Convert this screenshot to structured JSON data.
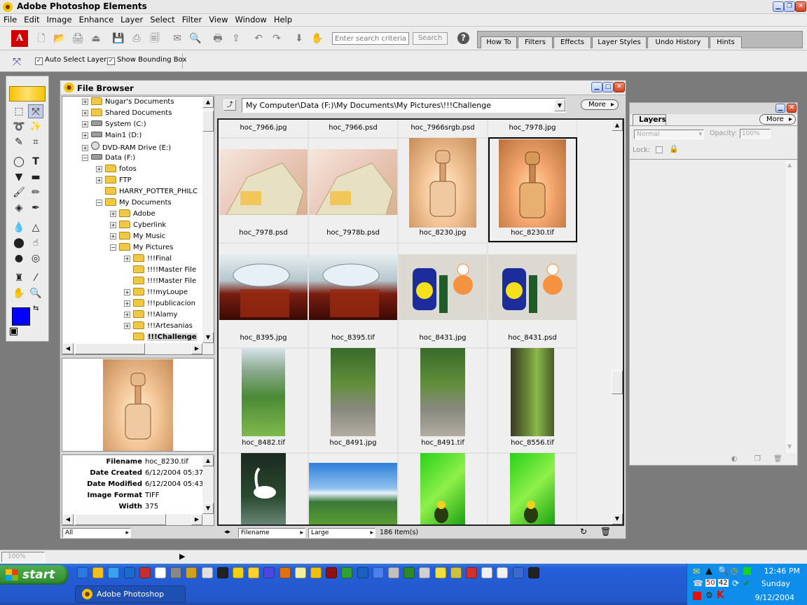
{
  "app": {
    "title": "Adobe Photoshop Elements"
  },
  "menu": [
    "File",
    "Edit",
    "Image",
    "Enhance",
    "Layer",
    "Select",
    "Filter",
    "View",
    "Window",
    "Help"
  ],
  "toolbar": {
    "search_placeholder": "Enter search criteria",
    "search_button": "Search",
    "palette_tabs": [
      "How To",
      "Filters",
      "Effects",
      "Layer Styles",
      "Undo History",
      "Hints"
    ]
  },
  "options": {
    "auto_select": "Auto Select Layer",
    "show_bbox": "Show Bounding Box"
  },
  "file_browser": {
    "title": "File Browser",
    "path": "My Computer\\Data (F:)\\My Documents\\My Pictures\\!!!Challenge",
    "more": "More",
    "tree": [
      {
        "label": "Nugar's Documents",
        "type": "folder",
        "indent": 1
      },
      {
        "label": "Shared Documents",
        "type": "folder",
        "indent": 1
      },
      {
        "label": "System (C:)",
        "type": "drive",
        "indent": 1
      },
      {
        "label": "Main1 (D:)",
        "type": "drive",
        "indent": 1
      },
      {
        "label": "DVD-RAM Drive (E:)",
        "type": "cd",
        "indent": 1
      },
      {
        "label": "Data (F:)",
        "type": "drive",
        "indent": 1,
        "open": true
      },
      {
        "label": "fotos",
        "type": "folder",
        "indent": 2
      },
      {
        "label": "FTP",
        "type": "folder",
        "indent": 2
      },
      {
        "label": "HARRY_POTTER_PHILC",
        "type": "folder",
        "indent": 2,
        "leaf": true
      },
      {
        "label": "My Documents",
        "type": "folder",
        "indent": 2,
        "open": true
      },
      {
        "label": "Adobe",
        "type": "folder",
        "indent": 3
      },
      {
        "label": "Cyberlink",
        "type": "folder",
        "indent": 3
      },
      {
        "label": "My Music",
        "type": "folder",
        "indent": 3
      },
      {
        "label": "My Pictures",
        "type": "folder",
        "indent": 3,
        "open": true
      },
      {
        "label": "!!!Final",
        "type": "folder",
        "indent": 4
      },
      {
        "label": "!!!!Master File",
        "type": "folder",
        "indent": 4,
        "leaf": true
      },
      {
        "label": "!!!!Master File",
        "type": "folder",
        "indent": 4,
        "leaf": true
      },
      {
        "label": "!!!myLoupe",
        "type": "folder",
        "indent": 4
      },
      {
        "label": "!!!publicacion",
        "type": "folder",
        "indent": 4
      },
      {
        "label": "!!!Alamy",
        "type": "folder",
        "indent": 4
      },
      {
        "label": "!!!Artesanias",
        "type": "folder",
        "indent": 4
      },
      {
        "label": "!!!Challenge",
        "type": "folder",
        "indent": 4,
        "leaf": true,
        "selected": true
      }
    ],
    "header_captions": [
      "hoc_7966.jpg",
      "hoc_7966.psd",
      "hoc_7966srgb.psd",
      "hoc_7978.jpg"
    ],
    "rows": [
      [
        "hoc_7978.psd",
        "hoc_7978b.psd",
        "hoc_8230.jpg",
        "hoc_8230.tif"
      ],
      [
        "hoc_8395.jpg",
        "hoc_8395.tif",
        "hoc_8431.jpg",
        "hoc_8431.psd"
      ],
      [
        "hoc_8482.tif",
        "hoc_8491.jpg",
        "hoc_8491.tif",
        "hoc_8556.tif"
      ]
    ],
    "metadata": [
      {
        "k": "Filename",
        "v": "hoc_8230.tif"
      },
      {
        "k": "Date Created",
        "v": "6/12/2004 05:37"
      },
      {
        "k": "Date Modified",
        "v": "6/12/2004 05:43"
      },
      {
        "k": "Image Format",
        "v": "TIFF"
      },
      {
        "k": "Width",
        "v": "375"
      }
    ],
    "meta_filter": "All",
    "sort_by": "Filename",
    "thumb_size": "Large",
    "item_count": "186 Item(s)"
  },
  "layers": {
    "title": "Layers",
    "more": "More",
    "blend": "Normal",
    "opacity_label": "Opacity:",
    "opacity": "100%",
    "lock_label": "Lock:"
  },
  "status": {
    "zoom": "100%"
  },
  "taskbar": {
    "start": "start",
    "task": "Adobe Photoshop Ele...",
    "time": "12:46 PM",
    "day": "Sunday",
    "date": "9/12/2004",
    "tray_a": "50",
    "tray_b": "42"
  },
  "colors": {
    "foreground": "#0000ff",
    "background": "#ffffff",
    "selection_border": "#000000"
  }
}
